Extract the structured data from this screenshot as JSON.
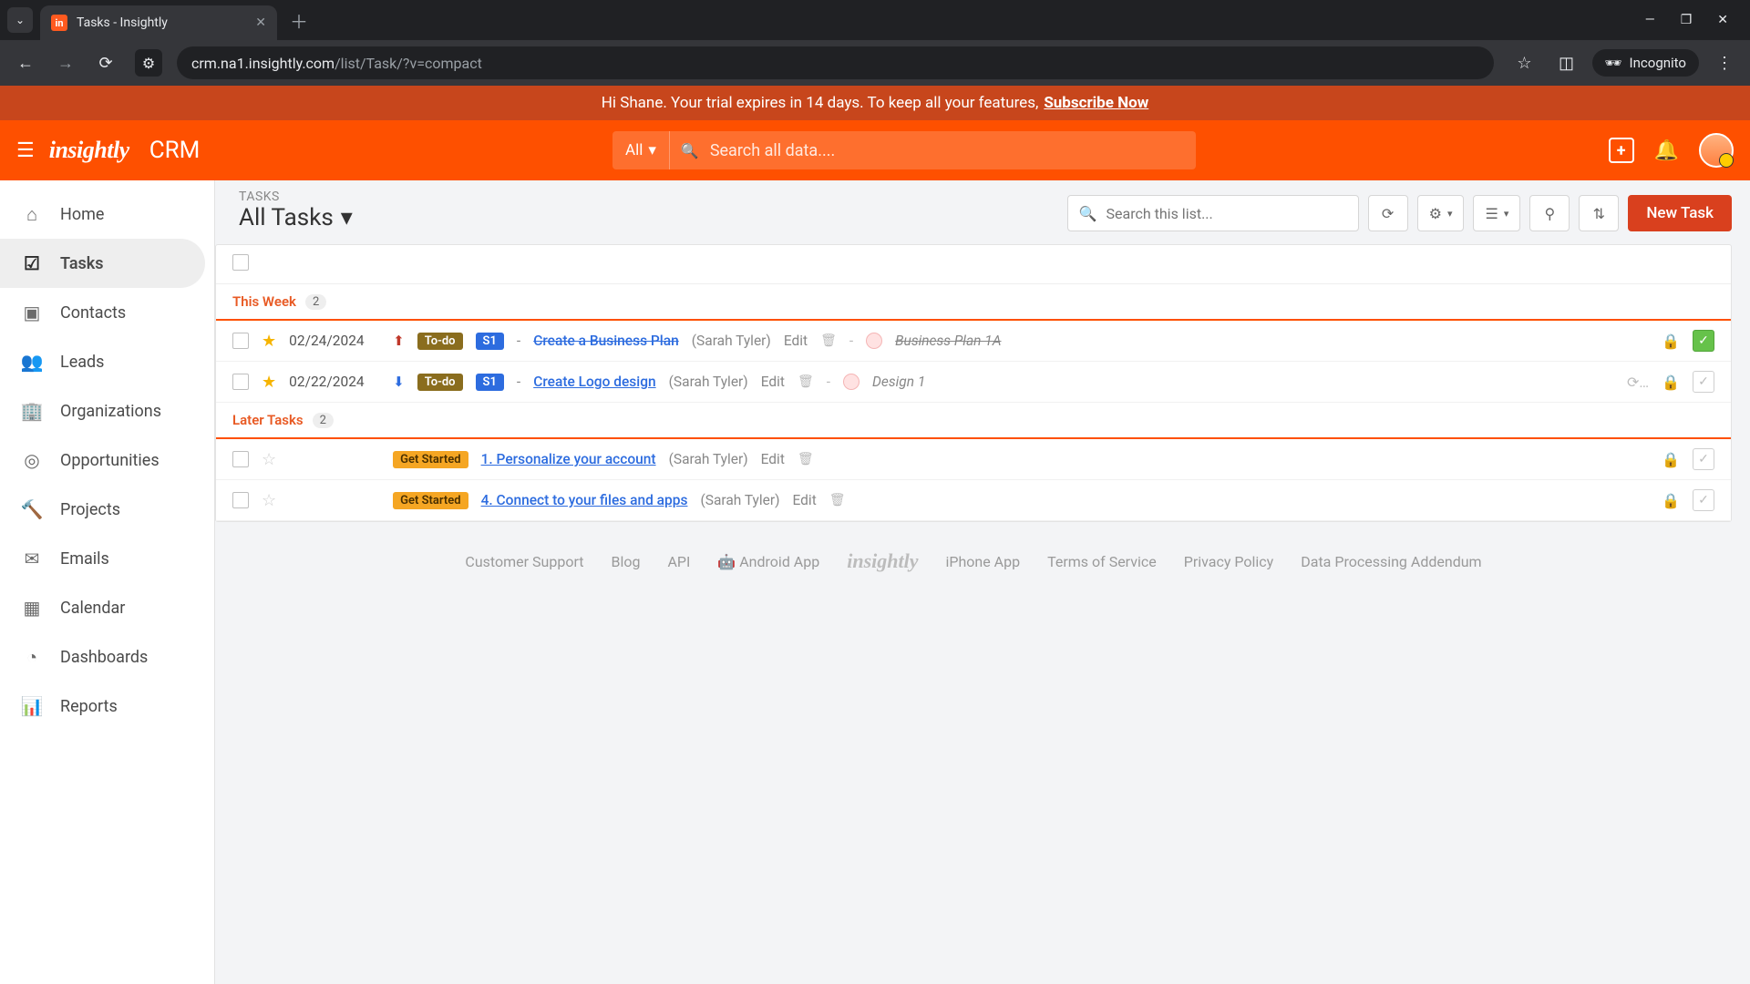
{
  "browser": {
    "tab_title": "Tasks - Insightly",
    "url_domain": "crm.na1.insightly.com",
    "url_path": "/list/Task/?v=compact",
    "incognito_label": "Incognito"
  },
  "banner": {
    "text": "Hi Shane. Your trial expires in 14 days. To keep all your features,",
    "cta": "Subscribe Now"
  },
  "header": {
    "logo": "insightly",
    "app": "CRM",
    "search_scope": "All",
    "search_placeholder": "Search all data...."
  },
  "sidebar": {
    "items": [
      {
        "icon": "⌂",
        "label": "Home"
      },
      {
        "icon": "☑",
        "label": "Tasks"
      },
      {
        "icon": "▣",
        "label": "Contacts"
      },
      {
        "icon": "👥",
        "label": "Leads"
      },
      {
        "icon": "🏢",
        "label": "Organizations"
      },
      {
        "icon": "◎",
        "label": "Opportunities"
      },
      {
        "icon": "🔨",
        "label": "Projects"
      },
      {
        "icon": "✉",
        "label": "Emails"
      },
      {
        "icon": "▦",
        "label": "Calendar"
      },
      {
        "icon": "◔",
        "label": "Dashboards"
      },
      {
        "icon": "📊",
        "label": "Reports"
      }
    ],
    "active_index": 1
  },
  "list": {
    "crumb": "TASKS",
    "view": "All Tasks",
    "search_placeholder": "Search this list...",
    "new_task": "New Task"
  },
  "sections": [
    {
      "name": "This Week",
      "count": "2",
      "rows": [
        {
          "starred": true,
          "date": "02/24/2024",
          "priority": "up",
          "status": "To-do",
          "stage": "S1",
          "title": "Create a Business Plan",
          "completed": true,
          "assignee": "(Sarah Tyler)",
          "edit": "Edit",
          "related": "Business Plan 1A",
          "sync": false
        },
        {
          "starred": true,
          "date": "02/22/2024",
          "priority": "down",
          "status": "To-do",
          "stage": "S1",
          "title": "Create Logo design",
          "completed": false,
          "assignee": "(Sarah Tyler)",
          "edit": "Edit",
          "related": "Design 1",
          "sync": true
        }
      ]
    },
    {
      "name": "Later Tasks",
      "count": "2",
      "rows": [
        {
          "starred": false,
          "date": "",
          "status": "Get Started",
          "title": "1. Personalize your account",
          "completed": false,
          "assignee": "(Sarah Tyler)",
          "edit": "Edit"
        },
        {
          "starred": false,
          "date": "",
          "status": "Get Started",
          "title": "4. Connect to your files and apps",
          "completed": false,
          "assignee": "(Sarah Tyler)",
          "edit": "Edit"
        }
      ]
    }
  ],
  "footer": {
    "links": [
      "Customer Support",
      "Blog",
      "API",
      "Android App",
      "iPhone App",
      "Terms of Service",
      "Privacy Policy",
      "Data Processing Addendum"
    ],
    "logo": "insightly"
  }
}
